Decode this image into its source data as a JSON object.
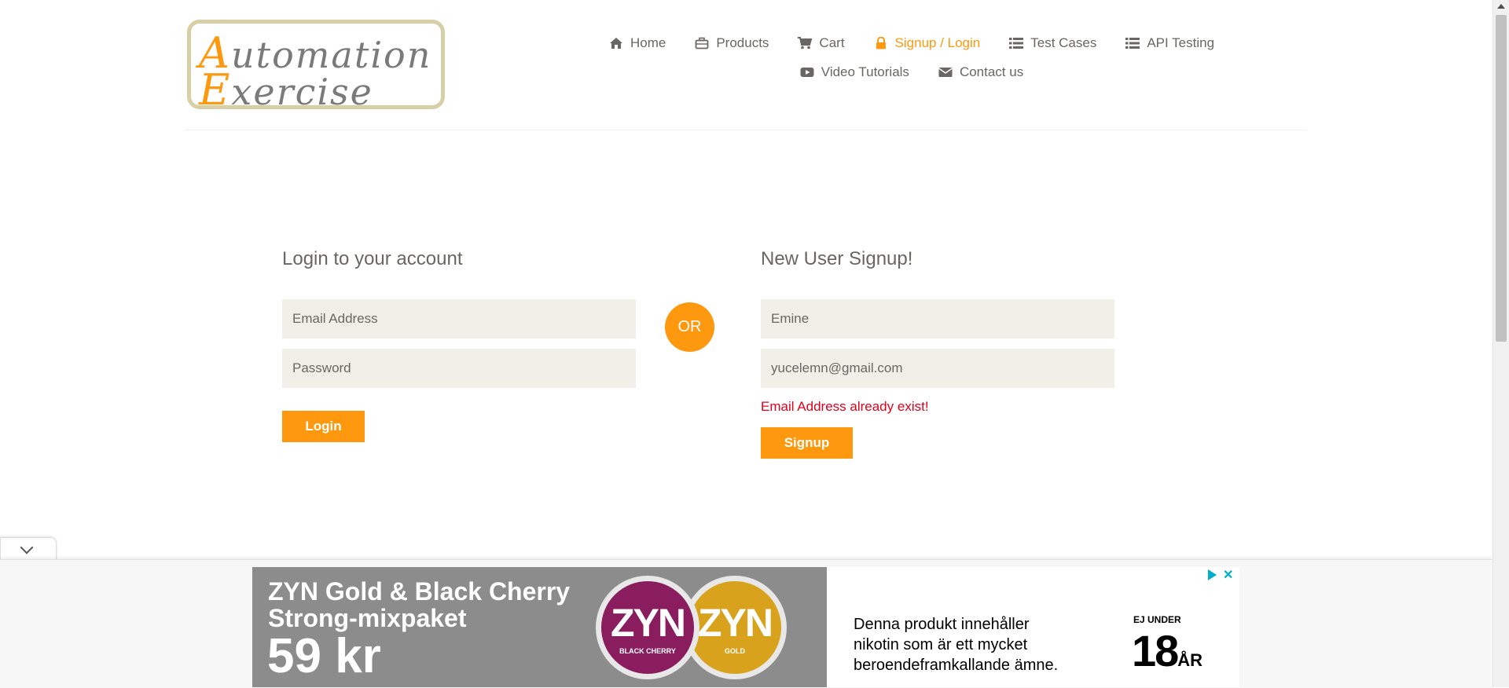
{
  "logo": {
    "line1_cap": "A",
    "line1_rest": "utomation",
    "line2_cap": "E",
    "line2_rest": "xercise"
  },
  "nav": {
    "row1": [
      {
        "label": "Home",
        "icon": "home-icon",
        "active": false
      },
      {
        "label": "Products",
        "icon": "briefcase-icon",
        "active": false
      },
      {
        "label": "Cart",
        "icon": "cart-icon",
        "active": false
      },
      {
        "label": "Signup / Login",
        "icon": "lock-icon",
        "active": true
      },
      {
        "label": "Test Cases",
        "icon": "list-icon",
        "active": false
      },
      {
        "label": "API Testing",
        "icon": "list-icon",
        "active": false
      }
    ],
    "row2": [
      {
        "label": "Video Tutorials",
        "icon": "youtube-play-icon",
        "active": false
      },
      {
        "label": "Contact us",
        "icon": "envelope-icon",
        "active": false
      }
    ]
  },
  "login": {
    "title": "Login to your account",
    "email_placeholder": "Email Address",
    "password_placeholder": "Password",
    "button": "Login"
  },
  "or_label": "OR",
  "signup": {
    "title": "New User Signup!",
    "name_value": "Emine",
    "email_value": "yucelemn@gmail.com",
    "error": "Email Address already exist!",
    "button": "Signup"
  },
  "ad": {
    "headline_line1": "ZYN Gold & Black Cherry",
    "headline_line2": "Strong-mixpaket",
    "price": "59 kr",
    "can1_brand": "ZYN",
    "can1_flavor": "BLACK CHERRY",
    "can2_brand": "ZYN",
    "can2_flavor": "GOLD",
    "warning_line1": "Denna produkt innehåller",
    "warning_line2": "nikotin som är ett mycket",
    "warning_line3": "beroendeframkallande ämne.",
    "age_prefix": "EJ UNDER",
    "age_number": "18",
    "age_suffix": "ÅR"
  },
  "colors": {
    "accent": "#fe980f",
    "error": "#e0001a",
    "input_bg": "#f0f0e9",
    "text": "#696763"
  }
}
